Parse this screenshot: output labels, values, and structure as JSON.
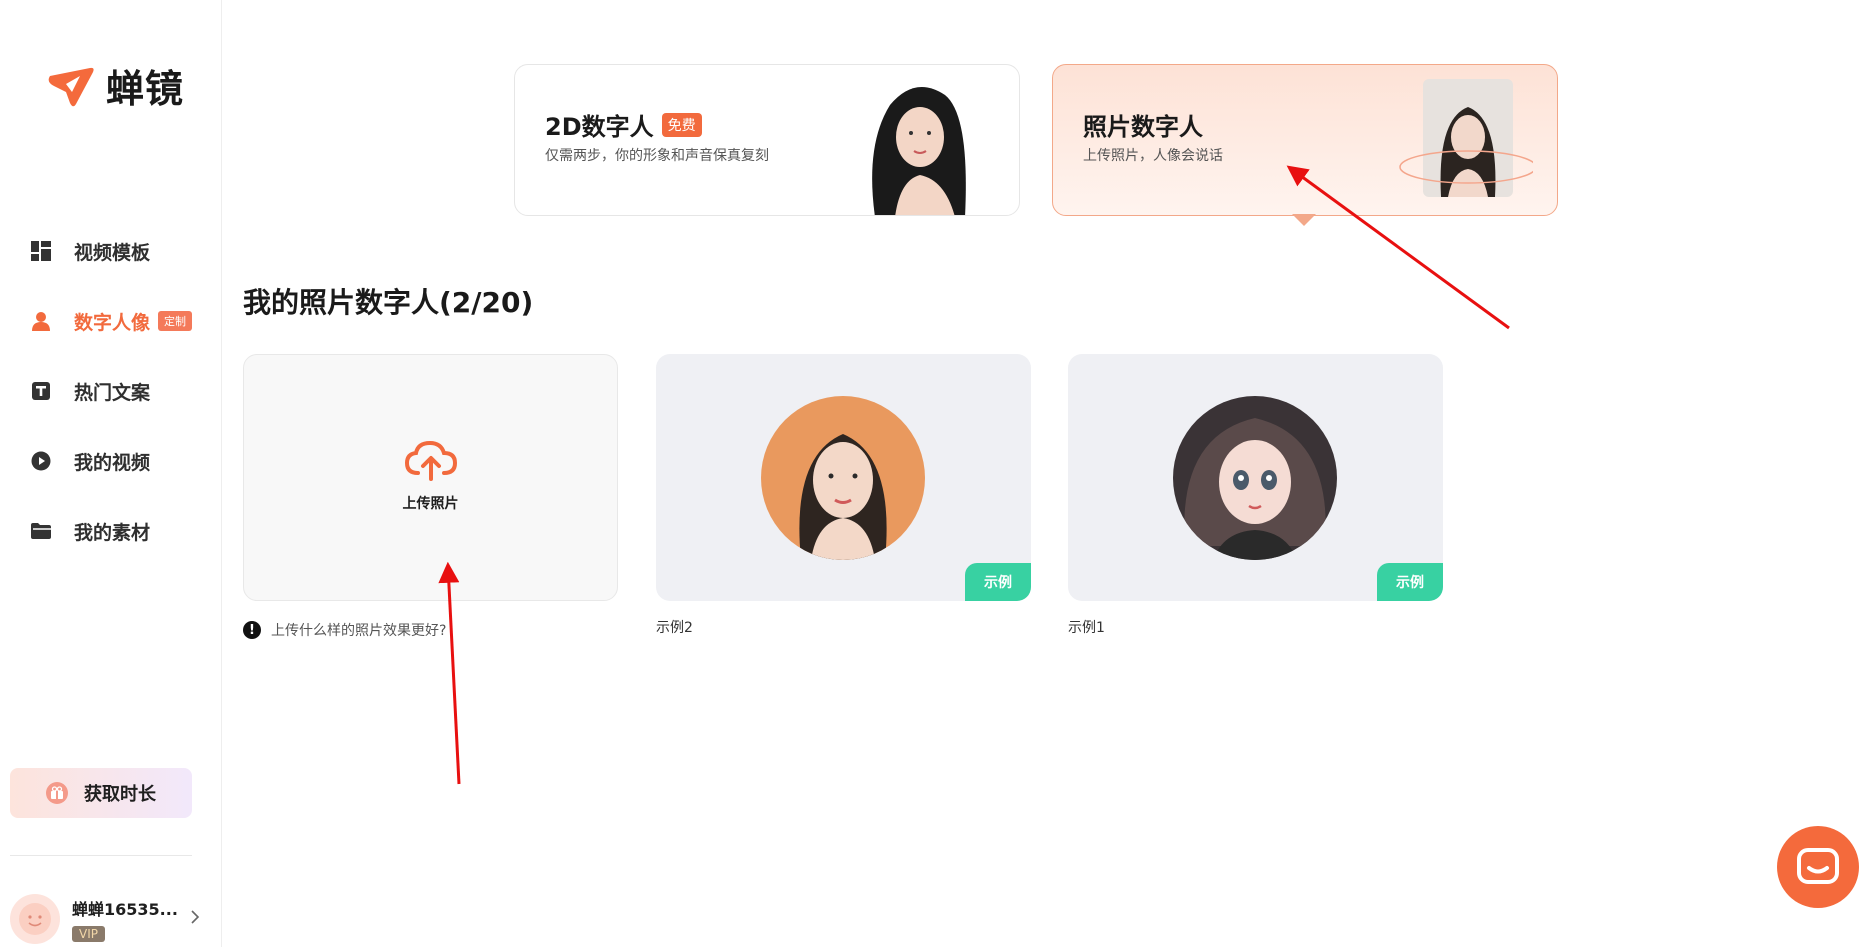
{
  "brand": {
    "name": "蝉镜"
  },
  "sidebar": {
    "items": [
      {
        "label": "视频模板",
        "icon": "dashboard-icon",
        "active": false
      },
      {
        "label": "数字人像",
        "icon": "user-icon",
        "active": true,
        "badge": "定制"
      },
      {
        "label": "热门文案",
        "icon": "text-doc-icon",
        "active": false
      },
      {
        "label": "我的视频",
        "icon": "play-circle-icon",
        "active": false
      },
      {
        "label": "我的素材",
        "icon": "folder-icon",
        "active": false
      }
    ],
    "get_time_label": "获取时长",
    "user": {
      "name": "蝉蝉16535...",
      "level": "VIP"
    }
  },
  "cards": {
    "twod": {
      "title": "2D数字人",
      "badge": "免费",
      "subtitle": "仅需两步，你的形象和声音保真复刻"
    },
    "photo": {
      "title": "照片数字人",
      "subtitle": "上传照片，人像会说话"
    }
  },
  "section": {
    "title": "我的照片数字人(2/20)"
  },
  "upload": {
    "label": "上传照片",
    "hint": "上传什么样的照片效果更好?"
  },
  "examples": [
    {
      "name": "示例2",
      "tag": "示例"
    },
    {
      "name": "示例1",
      "tag": "示例"
    }
  ],
  "colors": {
    "accent": "#f26a3d",
    "example_tag": "#38d1a2",
    "annotation": "#e81010"
  }
}
